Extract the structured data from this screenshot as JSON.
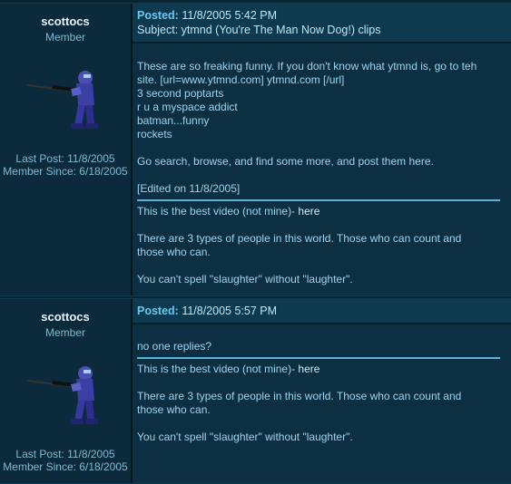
{
  "posts": [
    {
      "author": {
        "username": "scottocs",
        "rank": "Member",
        "last_post": "Last Post: 11/8/2005",
        "member_since": "Member Since: 6/18/2005",
        "avatar": "soldier-with-rifle-avatar"
      },
      "posted_label": "Posted:",
      "posted_date": "11/8/2005 5:42 PM",
      "subject": "Subject: ytmnd (You're The Man Now Dog!) clips",
      "body_lines": [
        "These are so freaking funny. If you don't know what ytmnd is, go to teh",
        "site. [url=www.ytmnd.com] ytmnd.com [/url]",
        "3 second poptarts",
        "r u a myspace addict",
        "batman...funny",
        "rockets",
        "",
        "Go search, browse, and find some more, and post them here.",
        "",
        "[Edited on 11/8/2005]"
      ]
    },
    {
      "author": {
        "username": "scottocs",
        "rank": "Member",
        "last_post": "Last Post: 11/8/2005",
        "member_since": "Member Since: 6/18/2005",
        "avatar": "soldier-with-rifle-avatar"
      },
      "posted_label": "Posted:",
      "posted_date": "11/8/2005 5:57 PM",
      "body_lines": [
        "no one replies?"
      ]
    }
  ],
  "signature": {
    "line1_prefix": "This is the best video (not mine)- ",
    "line1_link": "here",
    "line2": "There are 3 types of people in this world. Those who can count and",
    "line3": "those who can.",
    "line4": "You can't spell \"slaughter\" without \"laughter\"."
  },
  "colors": {
    "background": "#0a2533",
    "header": "#0e3a50",
    "accent": "#6cc7ee",
    "rule": "#5cb3d6"
  }
}
